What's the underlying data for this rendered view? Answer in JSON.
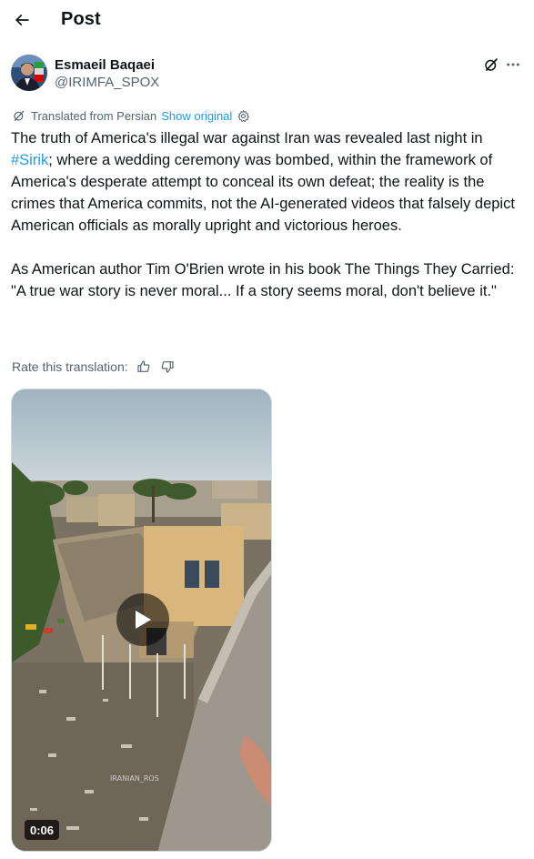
{
  "header": {
    "title": "Post"
  },
  "author": {
    "name": "Esmaeil Baqaei",
    "handle": "@IRIMFA_SPOX"
  },
  "translation": {
    "label": "Translated from Persian",
    "show_original": "Show original"
  },
  "post": {
    "p1_before": "The truth of America's illegal war against Iran was revealed last night in ",
    "hashtag": "#Sirik",
    "p1_after": "; where a wedding ceremony was bombed, within the framework of America's desperate attempt to conceal its own defeat; the reality is the crimes that America commits, not the AI-generated videos that falsely depict American officials as morally upright and victorious heroes.",
    "p2": "As American author Tim O'Brien wrote in his book The Things They Carried: \"A true war story is never moral... If a story seems moral, don't believe it.\""
  },
  "rate": {
    "label": "Rate this translation:"
  },
  "media": {
    "duration": "0:06",
    "watermark": "IRANIAN_ROS"
  },
  "icons": {
    "back": "arrow-left-icon",
    "grok": "grok-icon",
    "more": "more-horizontal-icon",
    "translate": "translate-icon",
    "settings": "gear-icon",
    "thumbs_up": "thumbs-up-icon",
    "thumbs_down": "thumbs-down-icon",
    "play": "play-icon"
  },
  "colors": {
    "link": "#1d9bf0",
    "secondary_text": "#536471",
    "primary_text": "#0f1419"
  }
}
